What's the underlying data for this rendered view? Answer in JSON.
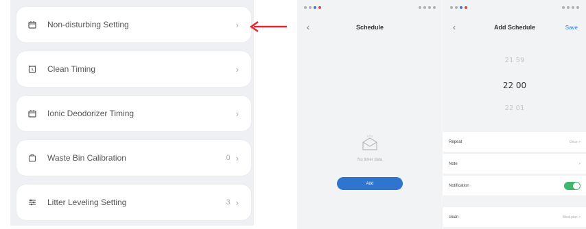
{
  "settings": {
    "items": [
      {
        "label": "Non-disturbing Setting",
        "value": "",
        "icon": "calendar-icon"
      },
      {
        "label": "Clean Timing",
        "value": "",
        "icon": "alarm-clock-icon"
      },
      {
        "label": "Ionic Deodorizer Timing",
        "value": "",
        "icon": "calendar-icon"
      },
      {
        "label": "Waste Bin Calibration",
        "value": "0",
        "icon": "bin-icon"
      },
      {
        "label": "Litter Leveling Setting",
        "value": "3",
        "icon": "leveling-icon"
      }
    ]
  },
  "arrow_color": "#e3262e",
  "schedule_screen": {
    "title": "Schedule",
    "empty_text": "No timer data",
    "add_label": "Add"
  },
  "add_schedule_screen": {
    "title": "Add Schedule",
    "save_label": "Save",
    "times": {
      "prev": "21 59",
      "current": "22 00",
      "next": "22 01"
    },
    "options": {
      "repeat_label": "Repeat",
      "repeat_value": "Once >",
      "note_label": "Note",
      "note_value": ">",
      "notification_label": "Notification",
      "notification_on": true,
      "clean_label": "clean",
      "clean_value": "Meal plan >"
    }
  },
  "colors": {
    "primary": "#2f74cf",
    "toggle_on": "#3fb66b",
    "panel_bg": "#eef0f3"
  }
}
